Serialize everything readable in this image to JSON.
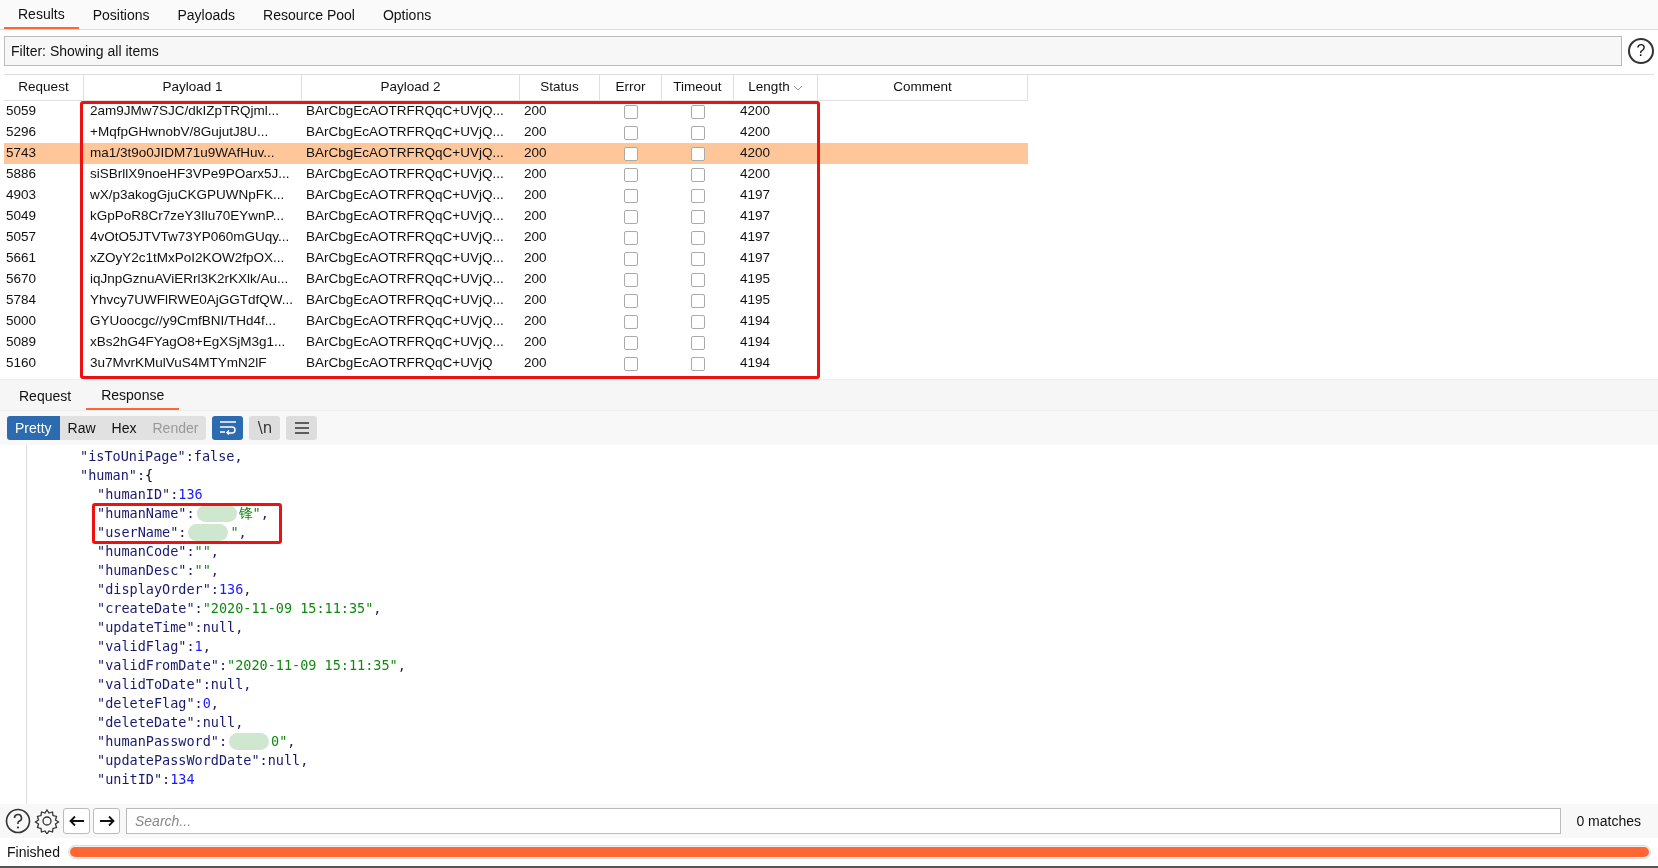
{
  "tabs": [
    {
      "label": "Results",
      "selected": true
    },
    {
      "label": "Positions",
      "selected": false
    },
    {
      "label": "Payloads",
      "selected": false
    },
    {
      "label": "Resource Pool",
      "selected": false
    },
    {
      "label": "Options",
      "selected": false
    }
  ],
  "filter": {
    "text": "Filter: Showing all items",
    "help_icon": "?"
  },
  "table": {
    "columns": [
      "Request",
      "Payload 1",
      "Payload 2",
      "Status",
      "Error",
      "Timeout",
      "Length",
      "Comment"
    ],
    "rows": [
      {
        "request": "5059",
        "payload_1": "2am9JMw7SJC/dkIZpTRQjml...",
        "payload_2": "BArCbgEcAOTRFRQqC+UVjQ...",
        "status": "200",
        "error": false,
        "timeout": false,
        "length": "4200",
        "selected": false
      },
      {
        "request": "5296",
        "payload_1": "+MqfpGHwnobV/8GujutJ8U...",
        "payload_2": "BArCbgEcAOTRFRQqC+UVjQ...",
        "status": "200",
        "error": false,
        "timeout": false,
        "length": "4200",
        "selected": false
      },
      {
        "request": "5743",
        "payload_1": "ma1/3t9o0JIDM71u9WAfHuv...",
        "payload_2": "BArCbgEcAOTRFRQqC+UVjQ...",
        "status": "200",
        "error": false,
        "timeout": false,
        "length": "4200",
        "selected": true
      },
      {
        "request": "5886",
        "payload_1": "siSBrllX9noeHF3VPe9POarx5J...",
        "payload_2": "BArCbgEcAOTRFRQqC+UVjQ...",
        "status": "200",
        "error": false,
        "timeout": false,
        "length": "4200",
        "selected": false
      },
      {
        "request": "4903",
        "payload_1": "wX/p3akogGjuCKGPUWNpFK...",
        "payload_2": "BArCbgEcAOTRFRQqC+UVjQ...",
        "status": "200",
        "error": false,
        "timeout": false,
        "length": "4197",
        "selected": false
      },
      {
        "request": "5049",
        "payload_1": "kGpPoR8Cr7zeY3Ilu70EYwnP...",
        "payload_2": "BArCbgEcAOTRFRQqC+UVjQ...",
        "status": "200",
        "error": false,
        "timeout": false,
        "length": "4197",
        "selected": false
      },
      {
        "request": "5057",
        "payload_1": "4vOtO5JTVTw73YP060mGUqy...",
        "payload_2": "BArCbgEcAOTRFRQqC+UVjQ...",
        "status": "200",
        "error": false,
        "timeout": false,
        "length": "4197",
        "selected": false
      },
      {
        "request": "5661",
        "payload_1": "xZOyY2c1tMxPoI2KOW2fpOX...",
        "payload_2": "BArCbgEcAOTRFRQqC+UVjQ...",
        "status": "200",
        "error": false,
        "timeout": false,
        "length": "4197",
        "selected": false
      },
      {
        "request": "5670",
        "payload_1": "iqJnpGznuAViERrl3K2rKXlk/Au...",
        "payload_2": "BArCbgEcAOTRFRQqC+UVjQ...",
        "status": "200",
        "error": false,
        "timeout": false,
        "length": "4195",
        "selected": false
      },
      {
        "request": "5784",
        "payload_1": "Yhvcy7UWFlRWE0AjGGTdfQW...",
        "payload_2": "BArCbgEcAOTRFRQqC+UVjQ...",
        "status": "200",
        "error": false,
        "timeout": false,
        "length": "4195",
        "selected": false
      },
      {
        "request": "5000",
        "payload_1": "GYUoocgc//y9CmfBNI/THd4f...",
        "payload_2": "BArCbgEcAOTRFRQqC+UVjQ...",
        "status": "200",
        "error": false,
        "timeout": false,
        "length": "4194",
        "selected": false
      },
      {
        "request": "5089",
        "payload_1": "xBs2hG4FYagO8+EgXSjM3g1...",
        "payload_2": "BArCbgEcAOTRFRQqC+UVjQ...",
        "status": "200",
        "error": false,
        "timeout": false,
        "length": "4194",
        "selected": false
      },
      {
        "request": "5160",
        "payload_1": "3u7MvrKMulVuS4MTYmN2lF",
        "payload_2": "BArCbgEcAOTRFRQqC+UVjQ",
        "status": "200",
        "error": false,
        "timeout": false,
        "length": "4194",
        "selected": false
      }
    ]
  },
  "message_tabs": [
    {
      "label": "Request",
      "selected": false
    },
    {
      "label": "Response",
      "selected": true
    }
  ],
  "view_modes": [
    {
      "label": "Pretty",
      "selected": true,
      "disabled": false
    },
    {
      "label": "Raw",
      "selected": false,
      "disabled": false
    },
    {
      "label": "Hex",
      "selected": false,
      "disabled": false
    },
    {
      "label": "Render",
      "selected": false,
      "disabled": true
    }
  ],
  "view_options": [
    {
      "kind": "wrap",
      "on": true
    },
    {
      "kind": "newline",
      "label": "\\n",
      "on": false
    },
    {
      "kind": "menu",
      "on": false
    }
  ],
  "response_lines": [
    {
      "key": "\"isToUniPage\":",
      "value": "false",
      "kind": "keyword",
      "tail": ","
    },
    {
      "key": "\"human\":",
      "value": "{",
      "kind": "punct",
      "children": [
        {
          "key": "\"humanID\":",
          "value": "136",
          "kind": "number"
        },
        {
          "key": "\"humanName\":",
          "value": "锋\"",
          "kind": "string",
          "tail": ",",
          "redacted": true
        },
        {
          "key": "\"userName\":",
          "value": "\"",
          "kind": "string",
          "tail": ",",
          "redacted": true
        },
        {
          "key": "\"humanCode\":",
          "value": "\"\"",
          "kind": "string",
          "tail": ","
        },
        {
          "key": "\"humanDesc\":",
          "value": "\"\"",
          "kind": "string",
          "tail": ","
        },
        {
          "key": "\"displayOrder\":",
          "value": "136",
          "kind": "number",
          "tail": ","
        },
        {
          "key": "\"createDate\":",
          "value": "\"2020-11-09 15:11:35\"",
          "kind": "string",
          "tail": ","
        },
        {
          "key": "\"updateTime\":",
          "value": "null",
          "kind": "keyword",
          "tail": ","
        },
        {
          "key": "\"validFlag\":",
          "value": "1",
          "kind": "number",
          "tail": ","
        },
        {
          "key": "\"validFromDate\":",
          "value": "\"2020-11-09 15:11:35\"",
          "kind": "string",
          "tail": ","
        },
        {
          "key": "\"validToDate\":",
          "value": "null",
          "kind": "keyword",
          "tail": ","
        },
        {
          "key": "\"deleteFlag\":",
          "value": "0",
          "kind": "number",
          "tail": ","
        },
        {
          "key": "\"deleteDate\":",
          "value": "null",
          "kind": "keyword",
          "tail": ","
        },
        {
          "key": "\"humanPassword\":",
          "value": "0\"",
          "kind": "string",
          "tail": ",",
          "redacted": true
        },
        {
          "key": "\"updatePassWordDate\":",
          "value": "null",
          "kind": "keyword",
          "tail": ","
        },
        {
          "key": "\"unitID\":",
          "value": "134",
          "kind": "number"
        }
      ]
    }
  ],
  "search": {
    "placeholder": "Search...",
    "matches": "0 matches"
  },
  "status": {
    "text": "Finished",
    "level": 1
  }
}
